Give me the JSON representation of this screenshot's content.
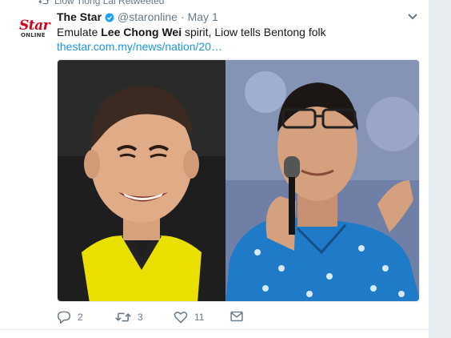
{
  "retweet_context": {
    "label": "Liow Tiong Lai Retweeted"
  },
  "tweet": {
    "avatar": {
      "brand_word": "Star",
      "brand_sub": "ONLINE",
      "brand_color": "#d0021b"
    },
    "author_name": "The Star",
    "handle": "@staronline",
    "separator": "·",
    "date": "May 1",
    "text_before": "Emulate ",
    "text_bold": "Lee Chong Wei",
    "text_after": " spirit, Liow tells Bentong folk",
    "link": "thestar.com.my/news/nation/20…",
    "media_alt": "Photo collage: badminton player smiling; politician speaking into microphone",
    "actions": {
      "reply_count": "2",
      "retweet_count": "3",
      "like_count": "11"
    }
  },
  "colors": {
    "link": "#1b95e0",
    "verified": "#1da1f2",
    "muted": "#657786",
    "background": "#e6ecf0"
  },
  "icons": {
    "retweeted_context": "retweet-icon",
    "verified": "verified-badge-icon",
    "menu": "chevron-down-icon",
    "reply": "reply-icon",
    "retweet": "retweet-icon",
    "like": "heart-icon",
    "dm": "envelope-icon"
  }
}
